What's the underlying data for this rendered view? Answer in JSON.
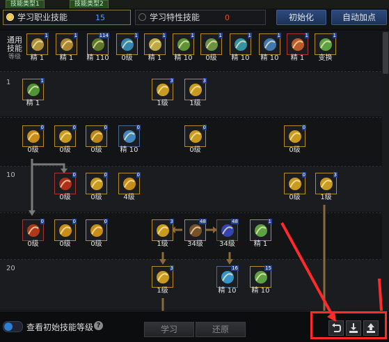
{
  "top_tabs": [
    "技能类型1",
    "技能类型2"
  ],
  "tabs": {
    "job": {
      "label": "学习职业技能",
      "count": "15"
    },
    "trait": {
      "label": "学习特性技能",
      "count": "0"
    }
  },
  "buttons": {
    "reset": "初始化",
    "auto": "自动加点",
    "learn": "学习",
    "revert": "还原"
  },
  "common": {
    "title": "通用\n技能",
    "sub": "等级"
  },
  "row_labels": [
    "1",
    "10",
    "20"
  ],
  "bottom": {
    "toggle_label": "查看初始技能等级",
    "help": "?"
  },
  "common_skills": [
    {
      "cap": "精 1",
      "badge": "1"
    },
    {
      "cap": "精 1",
      "badge": "1"
    },
    {
      "cap": "精 110",
      "badge": "114"
    },
    {
      "cap": "0级",
      "badge": "1"
    },
    {
      "cap": "精 1",
      "badge": "1"
    },
    {
      "cap": "精 10",
      "badge": "1"
    },
    {
      "cap": "0级",
      "badge": "1"
    },
    {
      "cap": "精 10",
      "badge": "1"
    },
    {
      "cap": "精 10",
      "badge": "1"
    },
    {
      "cap": "精 1",
      "badge": "1"
    },
    {
      "cap": "变换",
      "badge": "1"
    }
  ],
  "tree_skills": [
    {
      "cap": "精 1",
      "badge": "1"
    },
    {
      "cap": "1级",
      "badge": "3"
    },
    {
      "cap": "1级",
      "badge": "3"
    },
    {
      "cap": "0级",
      "badge": "0"
    },
    {
      "cap": "0级",
      "badge": "0"
    },
    {
      "cap": "0级",
      "badge": "0"
    },
    {
      "cap": "精 10",
      "badge": "0"
    },
    {
      "cap": "0级",
      "badge": "0"
    },
    {
      "cap": "0级",
      "badge": "0"
    },
    {
      "cap": "0级",
      "badge": "0"
    },
    {
      "cap": "0级",
      "badge": "0"
    },
    {
      "cap": "4级",
      "badge": "0"
    },
    {
      "cap": "0级",
      "badge": "0"
    },
    {
      "cap": "1级",
      "badge": "3"
    },
    {
      "cap": "0级",
      "badge": "0"
    },
    {
      "cap": "0级",
      "badge": "0"
    },
    {
      "cap": "0级",
      "badge": "0"
    },
    {
      "cap": "1级",
      "badge": "3"
    },
    {
      "cap": "34级",
      "badge": "48"
    },
    {
      "cap": "34级",
      "badge": "48"
    },
    {
      "cap": "精 1",
      "badge": "1"
    },
    {
      "cap": "1级",
      "badge": "3"
    },
    {
      "cap": "精 10",
      "badge": "16"
    },
    {
      "cap": "精 10",
      "badge": "15"
    }
  ]
}
